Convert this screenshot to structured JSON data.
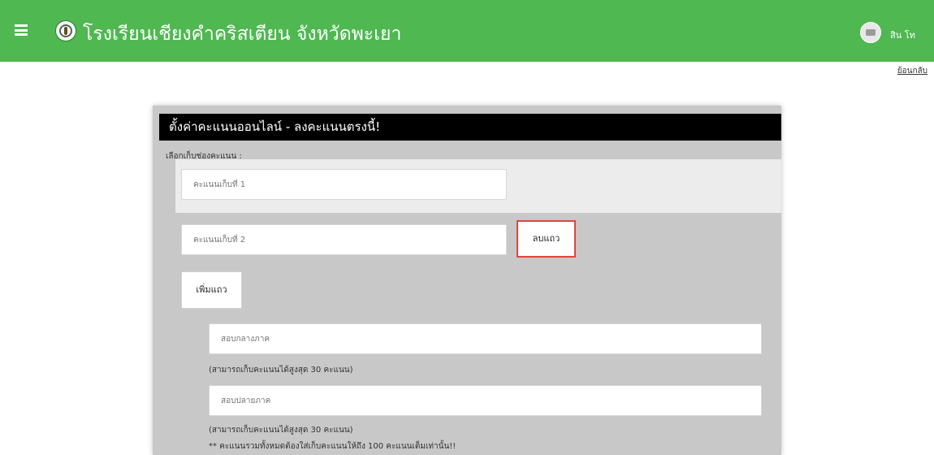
{
  "header": {
    "site_title": "โรงเรียนเชียงคำคริสเตียน จังหวัดพะเยา",
    "user_name": "สิน โท",
    "back_link": "ย้อนกลับ"
  },
  "panel": {
    "title": "ตั้งค่าคะแนนออนไลน์ - ลงคะแนนตรงนี้!",
    "select_label": "เลือกเก็บช่องคะแนน :",
    "rows": [
      {
        "placeholder": "คะแนนเก็บที่ 1"
      },
      {
        "placeholder": "คะแนนเก็บที่ 2"
      }
    ],
    "delete_row_label": "ลบแถว",
    "add_row_label": "เพิ่มแถว",
    "midterm_placeholder": "สอบกลางภาค",
    "midterm_note": "(สามารถเก็บคะแนนได้สูงสุด 30 คะแนน)",
    "final_placeholder": "สอบปลายภาค",
    "final_note": "(สามารถเก็บคะแนนได้สูงสุด 30 คะแนน)",
    "total_note": "** คะแนนรวมทั้งหมดต้องใส่เก็บคะแนนให้ถึง 100 คะแนนเต็มเท่านั้น!!"
  },
  "colors": {
    "topbar": "#4fb851",
    "panel_bg": "#c8c8c8",
    "header_bg": "#000000",
    "delete_border": "#e0453c"
  },
  "icons": {
    "menu": "hamburger-menu-icon",
    "logo": "school-logo",
    "avatar": "user-avatar"
  }
}
